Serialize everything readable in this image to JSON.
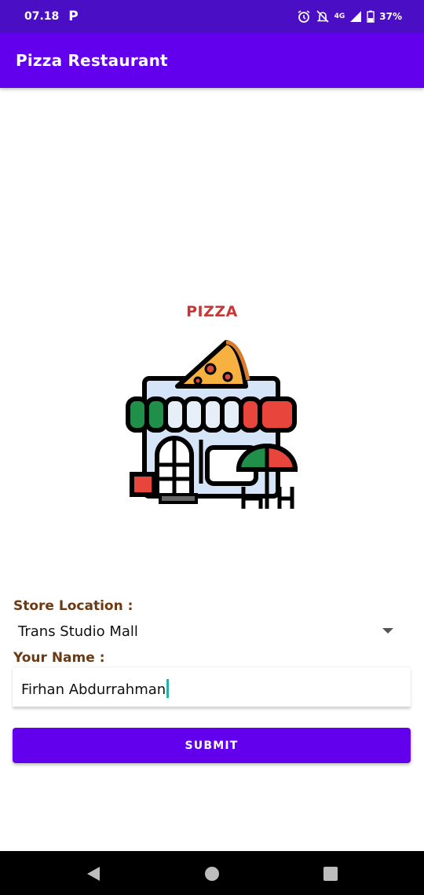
{
  "status_bar": {
    "time": "07.18",
    "network": "4G",
    "battery": "37%",
    "app_icon": "p-icon",
    "alarm_icon": "alarm-icon",
    "mute_icon": "notifications-off-icon",
    "signal_icon": "signal-icon",
    "battery_icon": "battery-icon"
  },
  "app_bar": {
    "title": "Pizza Restaurant",
    "background": "#6200ee"
  },
  "brand": {
    "title": "PIZZA",
    "color": "#c63737"
  },
  "illustration": {
    "icon": "pizza-store-icon"
  },
  "form": {
    "store_location_label": "Store Location :",
    "store_location_value": "Trans Studio Mall",
    "your_name_label": "Your Name :",
    "your_name_value": "Firhan Abdurrahman",
    "label_color": "#6b3a12"
  },
  "submit": {
    "label": "SUBMIT"
  },
  "nav": {
    "back_icon": "back-icon",
    "home_icon": "home-icon",
    "recents_icon": "recents-icon"
  }
}
